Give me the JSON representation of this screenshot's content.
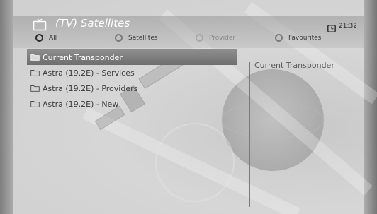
{
  "header": {
    "title": "(TV) Satellites",
    "time": "21:32"
  },
  "filters": [
    {
      "label": "All",
      "selected": true
    },
    {
      "label": "Satellites",
      "selected": false
    },
    {
      "label": "Provider",
      "selected": false
    },
    {
      "label": "Favourites",
      "selected": false
    }
  ],
  "list": {
    "items": [
      {
        "label": "Current Transponder",
        "selected": true
      },
      {
        "label": "Astra (19.2E) - Services",
        "selected": false
      },
      {
        "label": "Astra (19.2E) - Providers",
        "selected": false
      },
      {
        "label": "Astra (19.2E) - New",
        "selected": false
      }
    ]
  },
  "detail": {
    "title": "Current Transponder"
  },
  "icons": {
    "tv": "tv-icon",
    "clock": "clock-icon",
    "folder": "folder-icon"
  }
}
